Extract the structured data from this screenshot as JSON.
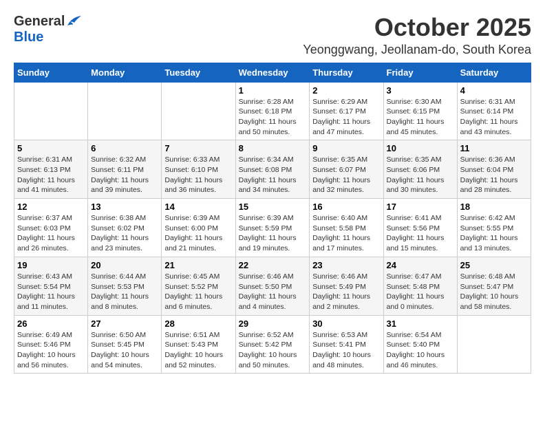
{
  "header": {
    "logo_general": "General",
    "logo_blue": "Blue",
    "month_title": "October 2025",
    "location": "Yeonggwang, Jeollanam-do, South Korea"
  },
  "weekdays": [
    "Sunday",
    "Monday",
    "Tuesday",
    "Wednesday",
    "Thursday",
    "Friday",
    "Saturday"
  ],
  "weeks": [
    [
      {
        "day": "",
        "info": ""
      },
      {
        "day": "",
        "info": ""
      },
      {
        "day": "",
        "info": ""
      },
      {
        "day": "1",
        "info": "Sunrise: 6:28 AM\nSunset: 6:18 PM\nDaylight: 11 hours\nand 50 minutes."
      },
      {
        "day": "2",
        "info": "Sunrise: 6:29 AM\nSunset: 6:17 PM\nDaylight: 11 hours\nand 47 minutes."
      },
      {
        "day": "3",
        "info": "Sunrise: 6:30 AM\nSunset: 6:15 PM\nDaylight: 11 hours\nand 45 minutes."
      },
      {
        "day": "4",
        "info": "Sunrise: 6:31 AM\nSunset: 6:14 PM\nDaylight: 11 hours\nand 43 minutes."
      }
    ],
    [
      {
        "day": "5",
        "info": "Sunrise: 6:31 AM\nSunset: 6:13 PM\nDaylight: 11 hours\nand 41 minutes."
      },
      {
        "day": "6",
        "info": "Sunrise: 6:32 AM\nSunset: 6:11 PM\nDaylight: 11 hours\nand 39 minutes."
      },
      {
        "day": "7",
        "info": "Sunrise: 6:33 AM\nSunset: 6:10 PM\nDaylight: 11 hours\nand 36 minutes."
      },
      {
        "day": "8",
        "info": "Sunrise: 6:34 AM\nSunset: 6:08 PM\nDaylight: 11 hours\nand 34 minutes."
      },
      {
        "day": "9",
        "info": "Sunrise: 6:35 AM\nSunset: 6:07 PM\nDaylight: 11 hours\nand 32 minutes."
      },
      {
        "day": "10",
        "info": "Sunrise: 6:35 AM\nSunset: 6:06 PM\nDaylight: 11 hours\nand 30 minutes."
      },
      {
        "day": "11",
        "info": "Sunrise: 6:36 AM\nSunset: 6:04 PM\nDaylight: 11 hours\nand 28 minutes."
      }
    ],
    [
      {
        "day": "12",
        "info": "Sunrise: 6:37 AM\nSunset: 6:03 PM\nDaylight: 11 hours\nand 26 minutes."
      },
      {
        "day": "13",
        "info": "Sunrise: 6:38 AM\nSunset: 6:02 PM\nDaylight: 11 hours\nand 23 minutes."
      },
      {
        "day": "14",
        "info": "Sunrise: 6:39 AM\nSunset: 6:00 PM\nDaylight: 11 hours\nand 21 minutes."
      },
      {
        "day": "15",
        "info": "Sunrise: 6:39 AM\nSunset: 5:59 PM\nDaylight: 11 hours\nand 19 minutes."
      },
      {
        "day": "16",
        "info": "Sunrise: 6:40 AM\nSunset: 5:58 PM\nDaylight: 11 hours\nand 17 minutes."
      },
      {
        "day": "17",
        "info": "Sunrise: 6:41 AM\nSunset: 5:56 PM\nDaylight: 11 hours\nand 15 minutes."
      },
      {
        "day": "18",
        "info": "Sunrise: 6:42 AM\nSunset: 5:55 PM\nDaylight: 11 hours\nand 13 minutes."
      }
    ],
    [
      {
        "day": "19",
        "info": "Sunrise: 6:43 AM\nSunset: 5:54 PM\nDaylight: 11 hours\nand 11 minutes."
      },
      {
        "day": "20",
        "info": "Sunrise: 6:44 AM\nSunset: 5:53 PM\nDaylight: 11 hours\nand 8 minutes."
      },
      {
        "day": "21",
        "info": "Sunrise: 6:45 AM\nSunset: 5:52 PM\nDaylight: 11 hours\nand 6 minutes."
      },
      {
        "day": "22",
        "info": "Sunrise: 6:46 AM\nSunset: 5:50 PM\nDaylight: 11 hours\nand 4 minutes."
      },
      {
        "day": "23",
        "info": "Sunrise: 6:46 AM\nSunset: 5:49 PM\nDaylight: 11 hours\nand 2 minutes."
      },
      {
        "day": "24",
        "info": "Sunrise: 6:47 AM\nSunset: 5:48 PM\nDaylight: 11 hours\nand 0 minutes."
      },
      {
        "day": "25",
        "info": "Sunrise: 6:48 AM\nSunset: 5:47 PM\nDaylight: 10 hours\nand 58 minutes."
      }
    ],
    [
      {
        "day": "26",
        "info": "Sunrise: 6:49 AM\nSunset: 5:46 PM\nDaylight: 10 hours\nand 56 minutes."
      },
      {
        "day": "27",
        "info": "Sunrise: 6:50 AM\nSunset: 5:45 PM\nDaylight: 10 hours\nand 54 minutes."
      },
      {
        "day": "28",
        "info": "Sunrise: 6:51 AM\nSunset: 5:43 PM\nDaylight: 10 hours\nand 52 minutes."
      },
      {
        "day": "29",
        "info": "Sunrise: 6:52 AM\nSunset: 5:42 PM\nDaylight: 10 hours\nand 50 minutes."
      },
      {
        "day": "30",
        "info": "Sunrise: 6:53 AM\nSunset: 5:41 PM\nDaylight: 10 hours\nand 48 minutes."
      },
      {
        "day": "31",
        "info": "Sunrise: 6:54 AM\nSunset: 5:40 PM\nDaylight: 10 hours\nand 46 minutes."
      },
      {
        "day": "",
        "info": ""
      }
    ]
  ]
}
